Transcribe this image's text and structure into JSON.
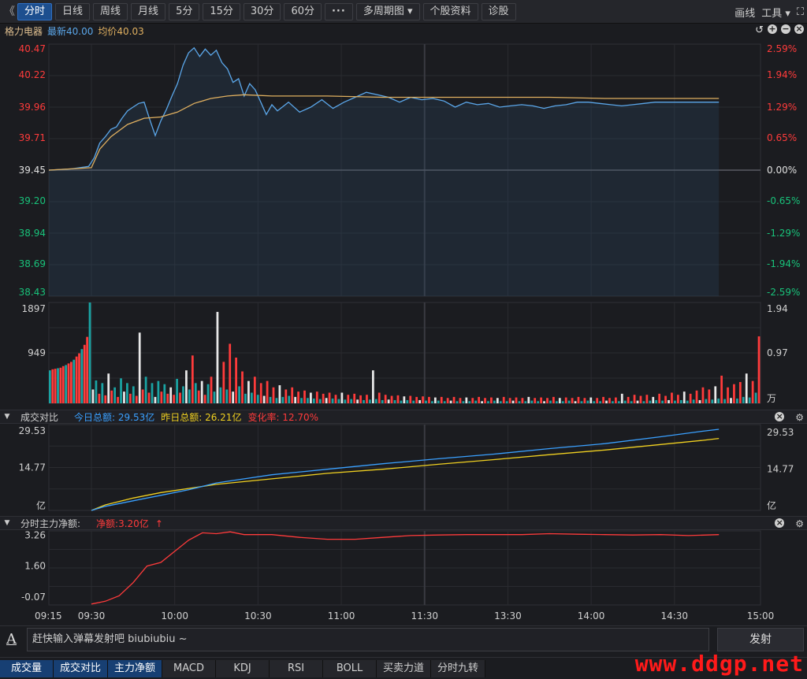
{
  "toolbar": {
    "collapse_icon": "double-chevron-left-icon",
    "collapse_glyph": "《",
    "periods": [
      "分时",
      "日线",
      "周线",
      "月线",
      "5分",
      "15分",
      "30分",
      "60分"
    ],
    "more_label": "···",
    "multi_label": "多周期图",
    "profile_label": "个股资料",
    "diagnose_label": "诊股",
    "draw_label": "画线",
    "tools_label": "工具",
    "fullscreen_glyph": "⛶"
  },
  "stock": {
    "name": "格力电器",
    "latest": "最新40.00",
    "avg": "均价40.03"
  },
  "colors": {
    "price_line": "#5ba7ea",
    "avg_line": "#e0b060",
    "up": "#ff3b3b",
    "down": "#18c27a",
    "bar_up": "#ff3b3b",
    "bar_down": "#1aa3a3",
    "today_line": "#3aa0ff",
    "yesterday_line": "#f0d020",
    "flow_line": "#ff3b3b"
  },
  "chart_data": [
    {
      "type": "line",
      "y_ticks_left": [
        "40.47",
        "40.22",
        "39.96",
        "39.71",
        "39.45",
        "39.20",
        "38.94",
        "38.69",
        "38.43"
      ],
      "y_ticks_right": [
        "2.59%",
        "1.94%",
        "1.29%",
        "0.65%",
        "0.00%",
        "-0.65%",
        "-1.29%",
        "-1.94%",
        "-2.59%"
      ],
      "ylim": [
        38.43,
        40.47
      ],
      "prev_close": 39.45,
      "x_ticks": [
        "09:15",
        "09:30",
        "10:00",
        "10:30",
        "11:00",
        "11:30",
        "13:30",
        "14:00",
        "14:30",
        "15:00"
      ],
      "price": [
        [
          0,
          39.45
        ],
        [
          8,
          39.46
        ],
        [
          14,
          39.48
        ],
        [
          16,
          39.55
        ],
        [
          18,
          39.67
        ],
        [
          20,
          39.72
        ],
        [
          22,
          39.78
        ],
        [
          24,
          39.8
        ],
        [
          26,
          39.87
        ],
        [
          28,
          39.93
        ],
        [
          30,
          39.96
        ],
        [
          32,
          39.99
        ],
        [
          34,
          40.0
        ],
        [
          36,
          39.86
        ],
        [
          38,
          39.73
        ],
        [
          40,
          39.85
        ],
        [
          42,
          39.94
        ],
        [
          44,
          40.05
        ],
        [
          46,
          40.15
        ],
        [
          48,
          40.3
        ],
        [
          50,
          40.4
        ],
        [
          52,
          40.44
        ],
        [
          54,
          40.37
        ],
        [
          56,
          40.43
        ],
        [
          58,
          40.38
        ],
        [
          60,
          40.42
        ],
        [
          62,
          40.32
        ],
        [
          64,
          40.27
        ],
        [
          66,
          40.16
        ],
        [
          68,
          40.19
        ],
        [
          70,
          40.05
        ],
        [
          72,
          40.15
        ],
        [
          74,
          40.1
        ],
        [
          76,
          40.0
        ],
        [
          78,
          39.9
        ],
        [
          80,
          39.98
        ],
        [
          82,
          39.93
        ],
        [
          86,
          40.0
        ],
        [
          90,
          39.92
        ],
        [
          94,
          39.96
        ],
        [
          98,
          40.02
        ],
        [
          102,
          39.95
        ],
        [
          106,
          40.0
        ],
        [
          110,
          40.04
        ],
        [
          114,
          40.08
        ],
        [
          118,
          40.06
        ],
        [
          122,
          40.04
        ],
        [
          126,
          40.0
        ],
        [
          130,
          40.04
        ],
        [
          134,
          40.02
        ],
        [
          138,
          40.03
        ],
        [
          142,
          40.01
        ],
        [
          146,
          39.96
        ],
        [
          150,
          40.0
        ],
        [
          154,
          39.98
        ],
        [
          158,
          39.99
        ],
        [
          162,
          39.96
        ],
        [
          166,
          39.97
        ],
        [
          170,
          39.98
        ],
        [
          174,
          39.97
        ],
        [
          178,
          39.95
        ],
        [
          182,
          39.97
        ],
        [
          186,
          39.98
        ],
        [
          190,
          40.0
        ],
        [
          194,
          40.0
        ],
        [
          198,
          39.99
        ],
        [
          202,
          39.98
        ],
        [
          206,
          39.97
        ],
        [
          210,
          39.98
        ],
        [
          214,
          39.99
        ],
        [
          218,
          40.0
        ],
        [
          222,
          40.0
        ],
        [
          226,
          40.0
        ],
        [
          230,
          40.0
        ],
        [
          234,
          40.0
        ],
        [
          238,
          40.0
        ],
        [
          241,
          40.0
        ]
      ],
      "avg": [
        [
          0,
          39.45
        ],
        [
          15,
          39.47
        ],
        [
          18,
          39.62
        ],
        [
          22,
          39.72
        ],
        [
          28,
          39.82
        ],
        [
          34,
          39.87
        ],
        [
          40,
          39.88
        ],
        [
          46,
          39.92
        ],
        [
          52,
          39.99
        ],
        [
          58,
          40.03
        ],
        [
          64,
          40.05
        ],
        [
          70,
          40.06
        ],
        [
          80,
          40.05
        ],
        [
          100,
          40.05
        ],
        [
          120,
          40.04
        ],
        [
          140,
          40.04
        ],
        [
          160,
          40.04
        ],
        [
          180,
          40.04
        ],
        [
          200,
          40.03
        ],
        [
          220,
          40.03
        ],
        [
          241,
          40.03
        ]
      ]
    },
    {
      "type": "bar",
      "name": "成交量",
      "y_ticks_left": [
        "1897",
        "949"
      ],
      "y_ticks_right": [
        "1.94",
        "0.97",
        "万"
      ],
      "ymax": 1897,
      "auction_values": [
        620,
        640,
        650,
        660,
        670,
        700,
        720,
        750,
        780,
        820,
        880,
        940,
        1020,
        1100,
        1250,
        1897
      ],
      "values": [
        260,
        430,
        180,
        380,
        150,
        560,
        240,
        300,
        120,
        470,
        220,
        380,
        180,
        320,
        140,
        1330,
        260,
        500,
        200,
        380,
        120,
        420,
        220,
        360,
        180,
        300,
        160,
        460,
        200,
        320,
        620,
        260,
        900,
        380,
        240,
        420,
        160,
        360,
        500,
        220,
        1720,
        300,
        780,
        260,
        1120,
        220,
        860,
        320,
        600,
        180,
        420,
        200,
        500,
        160,
        380,
        140,
        420,
        120,
        300,
        100,
        340,
        120,
        260,
        140,
        300,
        120,
        220,
        100,
        240,
        100,
        200,
        90,
        220,
        80,
        180,
        100,
        200,
        90,
        160,
        80,
        200,
        70,
        160,
        80,
        180,
        70,
        150,
        60,
        160,
        70,
        620,
        80,
        200,
        60,
        160,
        70,
        140,
        60,
        150,
        50,
        130,
        60,
        140,
        50,
        120,
        60,
        130,
        50,
        120,
        40,
        110,
        50,
        120,
        40,
        100,
        50,
        120,
        40,
        100,
        40,
        110,
        40,
        100,
        50,
        120,
        40,
        100,
        40,
        110,
        50,
        100,
        40,
        120,
        40,
        100,
        50,
        110,
        40,
        100,
        40,
        120,
        50,
        100,
        40,
        110,
        40,
        100,
        50,
        120,
        40,
        100,
        40,
        110,
        50,
        100,
        40,
        120,
        40,
        100,
        50,
        110,
        40,
        100,
        40,
        120,
        50,
        100,
        40,
        110,
        40,
        180,
        50,
        120,
        40,
        160,
        50,
        140,
        40,
        160,
        50,
        120,
        60,
        180,
        50,
        140,
        60,
        200,
        50,
        160,
        60,
        220,
        50,
        180,
        70,
        240,
        60,
        300,
        80,
        260,
        70,
        320,
        90,
        520,
        80,
        300,
        100,
        360,
        90,
        400,
        120,
        560,
        110,
        420,
        200,
        1260
      ]
    },
    {
      "type": "line",
      "name": "成交对比",
      "y_ticks_left": [
        "29.53",
        "14.77",
        "亿"
      ],
      "y_ticks_right": [
        "29.53",
        "14.77",
        "亿"
      ],
      "ymax": 29.53,
      "today": [
        [
          15,
          0
        ],
        [
          20,
          1.5
        ],
        [
          30,
          3.5
        ],
        [
          40,
          5.5
        ],
        [
          50,
          7.5
        ],
        [
          60,
          10.0
        ],
        [
          70,
          11.5
        ],
        [
          80,
          13.0
        ],
        [
          100,
          15.0
        ],
        [
          120,
          17.0
        ],
        [
          140,
          18.8
        ],
        [
          160,
          20.5
        ],
        [
          180,
          22.5
        ],
        [
          200,
          24.3
        ],
        [
          220,
          26.8
        ],
        [
          235,
          28.8
        ],
        [
          241,
          29.53
        ]
      ],
      "yesterday": [
        [
          15,
          0
        ],
        [
          20,
          2.0
        ],
        [
          30,
          4.5
        ],
        [
          40,
          6.5
        ],
        [
          50,
          8.0
        ],
        [
          60,
          9.5
        ],
        [
          70,
          10.5
        ],
        [
          80,
          11.5
        ],
        [
          100,
          13.5
        ],
        [
          120,
          15.0
        ],
        [
          140,
          16.8
        ],
        [
          160,
          18.5
        ],
        [
          180,
          20.3
        ],
        [
          200,
          22.0
        ],
        [
          220,
          24.0
        ],
        [
          235,
          25.5
        ],
        [
          241,
          26.21
        ]
      ]
    },
    {
      "type": "line",
      "name": "分时主力净额",
      "y_ticks_left": [
        "3.26",
        "1.60",
        "-0.07"
      ],
      "ylim": [
        -0.5,
        3.5
      ],
      "net": [
        [
          15,
          -0.45
        ],
        [
          20,
          -0.3
        ],
        [
          25,
          0.0
        ],
        [
          30,
          0.7
        ],
        [
          35,
          1.6
        ],
        [
          40,
          1.8
        ],
        [
          45,
          2.4
        ],
        [
          50,
          3.0
        ],
        [
          55,
          3.4
        ],
        [
          60,
          3.35
        ],
        [
          65,
          3.45
        ],
        [
          70,
          3.3
        ],
        [
          80,
          3.3
        ],
        [
          90,
          3.15
        ],
        [
          100,
          3.05
        ],
        [
          110,
          3.05
        ],
        [
          120,
          3.15
        ],
        [
          130,
          3.25
        ],
        [
          140,
          3.28
        ],
        [
          150,
          3.3
        ],
        [
          160,
          3.3
        ],
        [
          170,
          3.3
        ],
        [
          180,
          3.35
        ],
        [
          190,
          3.32
        ],
        [
          200,
          3.3
        ],
        [
          210,
          3.28
        ],
        [
          220,
          3.3
        ],
        [
          230,
          3.25
        ],
        [
          241,
          3.3
        ]
      ]
    }
  ],
  "compare": {
    "label": "成交对比",
    "today": "今日总额: 29.53亿",
    "yesterday": "昨日总额: 26.21亿",
    "ratio": "变化率: 12.70%"
  },
  "netflow": {
    "label": "分时主力净额:",
    "value": "净额:3.20亿",
    "arrow": "↑"
  },
  "danmaku": {
    "icon": "font-a-icon",
    "icon_glyph": "A",
    "placeholder": "赶快输入弹幕发射吧 biubiubiu ~",
    "send_label": "发射"
  },
  "tabs": [
    "成交量",
    "成交对比",
    "主力净额",
    "MACD",
    "KDJ",
    "RSI",
    "BOLL",
    "买卖力道",
    "分时九转"
  ],
  "watermark": "www.ddgp.net"
}
